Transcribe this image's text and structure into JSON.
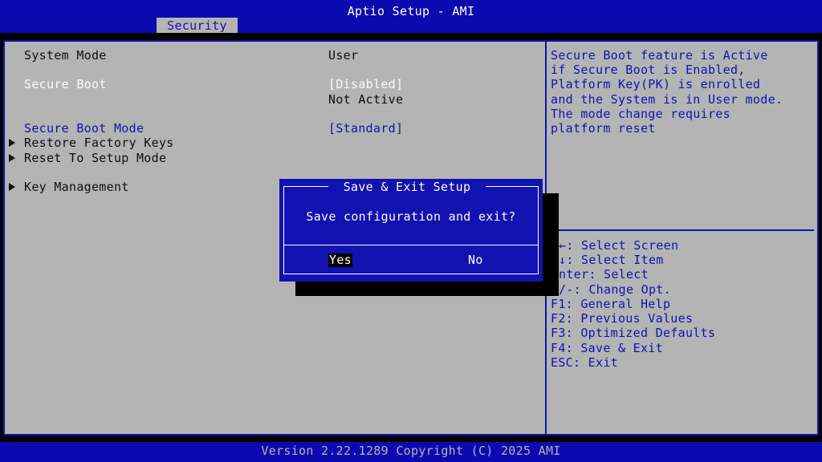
{
  "header": {
    "title": "Aptio Setup - AMI",
    "active_tab": "Security"
  },
  "settings": {
    "system_mode": {
      "label": "System Mode",
      "value": "User"
    },
    "secure_boot": {
      "label": "Secure Boot",
      "value": "[Disabled]",
      "status": "Not Active"
    },
    "secure_boot_mode": {
      "label": "Secure Boot Mode",
      "value": "[Standard]"
    },
    "submenus": [
      "Restore Factory Keys",
      "Reset To Setup Mode",
      "Key Management"
    ]
  },
  "help": {
    "description": [
      "Secure Boot feature is Active",
      "if Secure Boot is Enabled,",
      "Platform Key(PK) is enrolled",
      "and the System is in User mode.",
      "The mode change requires",
      "platform reset"
    ],
    "keys": [
      "←: Select Screen",
      "↓: Select Item",
      "nter: Select",
      "/-: Change Opt.",
      "F1: General Help",
      "F2: Previous Values",
      "F3: Optimized Defaults",
      "F4: Save & Exit",
      "ESC: Exit"
    ]
  },
  "dialog": {
    "title": "Save & Exit Setup",
    "message": "Save configuration and exit?",
    "yes_label": "Yes",
    "no_label": "No",
    "selected": "Yes"
  },
  "footer": {
    "version": "Version 2.22.1289 Copyright (C) 2025 AMI"
  },
  "colors": {
    "bios_blue": "#1212b0",
    "panel_gray": "#b4b4b4",
    "text_dark": "#101010",
    "text_white": "#fafafa"
  }
}
